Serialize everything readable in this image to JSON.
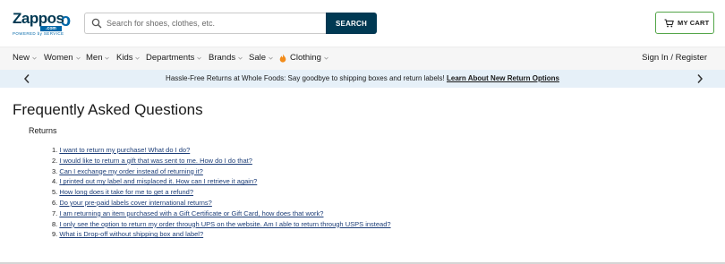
{
  "header": {
    "logo_text": "Zappos",
    "logo_badge": ".com",
    "logo_tagline": "POWERED by SERVICE",
    "search_placeholder": "Search for shoes, clothes, etc.",
    "search_button": "SEARCH",
    "cart_label": "MY CART"
  },
  "nav": {
    "items": [
      {
        "label": "New",
        "has_chevron": true
      },
      {
        "label": "Women",
        "has_chevron": true
      },
      {
        "label": "Men",
        "has_chevron": true
      },
      {
        "label": "Kids",
        "has_chevron": true
      },
      {
        "label": "Departments",
        "has_chevron": true
      },
      {
        "label": "Brands",
        "has_chevron": true
      },
      {
        "label": "Sale",
        "has_chevron": true
      },
      {
        "label": "Clothing",
        "has_chevron": true,
        "icon": "flame-icon"
      }
    ],
    "signin": "Sign In / Register"
  },
  "banner": {
    "text": "Hassle-Free Returns at Whole Foods: Say goodbye to shipping boxes and return labels!",
    "link": "Learn About New Return Options"
  },
  "main": {
    "title": "Frequently Asked Questions",
    "section": "Returns",
    "questions": [
      "I want to return my purchase! What do I do?",
      "I would like to return a gift that was sent to me. How do I do that?",
      "Can I exchange my order instead of returning it?",
      "I printed out my label and misplaced it. How can I retrieve it again?",
      "How long does it take for me to get a refund?",
      "Do your pre-paid labels cover international returns?",
      "I am returning an item purchased with a Gift Certificate or Gift Card, how does that work?",
      "I only see the option to return my order through UPS on the website. Am I able to return through USPS instead?",
      "What is Drop-off without shipping box and label?"
    ]
  },
  "colors": {
    "brand_navy": "#003953",
    "brand_blue": "#0067a8",
    "cart_border": "#53a548",
    "banner_bg": "#e6f0f8",
    "link": "#1d3e78",
    "flame": "#f28c1b"
  }
}
